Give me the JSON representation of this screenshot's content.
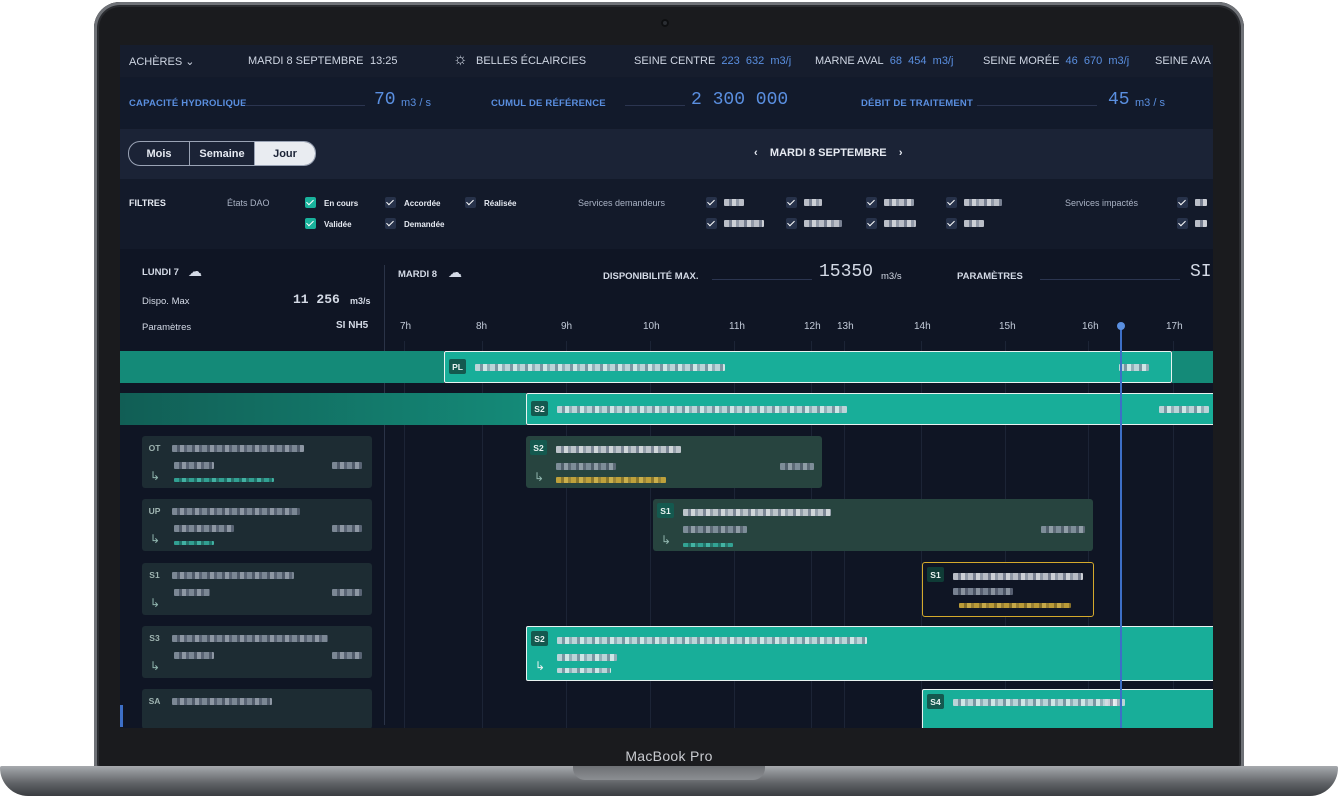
{
  "device": {
    "label": "MacBook Pro"
  },
  "topbar": {
    "site": "ACHÈRES",
    "date": "MARDI 8 SEPTEMBRE",
    "time": "13:25",
    "weather": "BELLES ÉCLAIRCIES",
    "stations": [
      {
        "name": "SEINE CENTRE",
        "v1": "223",
        "v2": "632",
        "unit": "m3/j"
      },
      {
        "name": "MARNE AVAL",
        "v1": "68",
        "v2": "454",
        "unit": "m3/j"
      },
      {
        "name": "SEINE MORÉE",
        "v1": "46",
        "v2": "670",
        "unit": "m3/j"
      },
      {
        "name": "SEINE AVA",
        "v1": "",
        "v2": "",
        "unit": ""
      }
    ]
  },
  "kpis": [
    {
      "label": "CAPACITÉ HYDROLIQUE",
      "value": "70",
      "unit": "m3 / s"
    },
    {
      "label": "CUMUL DE RÉFÉRENCE",
      "value": "2 300 000",
      "unit": ""
    },
    {
      "label": "DÉBIT DE TRAITEMENT",
      "value": "45",
      "unit": "m3 / s"
    }
  ],
  "view": {
    "tabs": [
      "Mois",
      "Semaine",
      "Jour"
    ],
    "active": "Jour",
    "current_date": "MARDI 8 SEPTEMBRE"
  },
  "filters": {
    "title": "FILTRES",
    "states_label": "États DAO",
    "states": [
      {
        "label": "En cours",
        "checked": true
      },
      {
        "label": "Accordée",
        "checked": true
      },
      {
        "label": "Réalisée",
        "checked": true
      },
      {
        "label": "Validée",
        "checked": true
      },
      {
        "label": "Demandée",
        "checked": true
      }
    ],
    "requesters_label": "Services demandeurs",
    "impacted_label": "Services impactés"
  },
  "day_prev": {
    "name": "LUNDI 7",
    "dispo_label": "Dispo. Max",
    "dispo_value": "11 256",
    "dispo_unit": "m3/s",
    "params_label": "Paramètres",
    "params_value": "SI NH5"
  },
  "day_curr": {
    "name": "MARDI 8",
    "dispo_label": "DISPONIBILITÉ MAX.",
    "dispo_value": "15350",
    "dispo_unit": "m3/s",
    "params_label": "PARAMÈTRES",
    "params_value": "SI"
  },
  "hours": [
    "7h",
    "8h",
    "9h",
    "10h",
    "11h",
    "12h",
    "13h",
    "14h",
    "15h",
    "16h",
    "17h"
  ],
  "events": {
    "pl": "PL",
    "s2a": "S2",
    "s2b": "S2",
    "s1a": "S1",
    "s1b": "S1",
    "s2c": "S2",
    "s4": "S4",
    "left": [
      "OT",
      "UP",
      "S1",
      "S3",
      "SA"
    ]
  },
  "colors": {
    "accent": "#5a8fe0",
    "teal": "#18ae99",
    "gold": "#d4a92c",
    "bg": "#131a2a"
  }
}
